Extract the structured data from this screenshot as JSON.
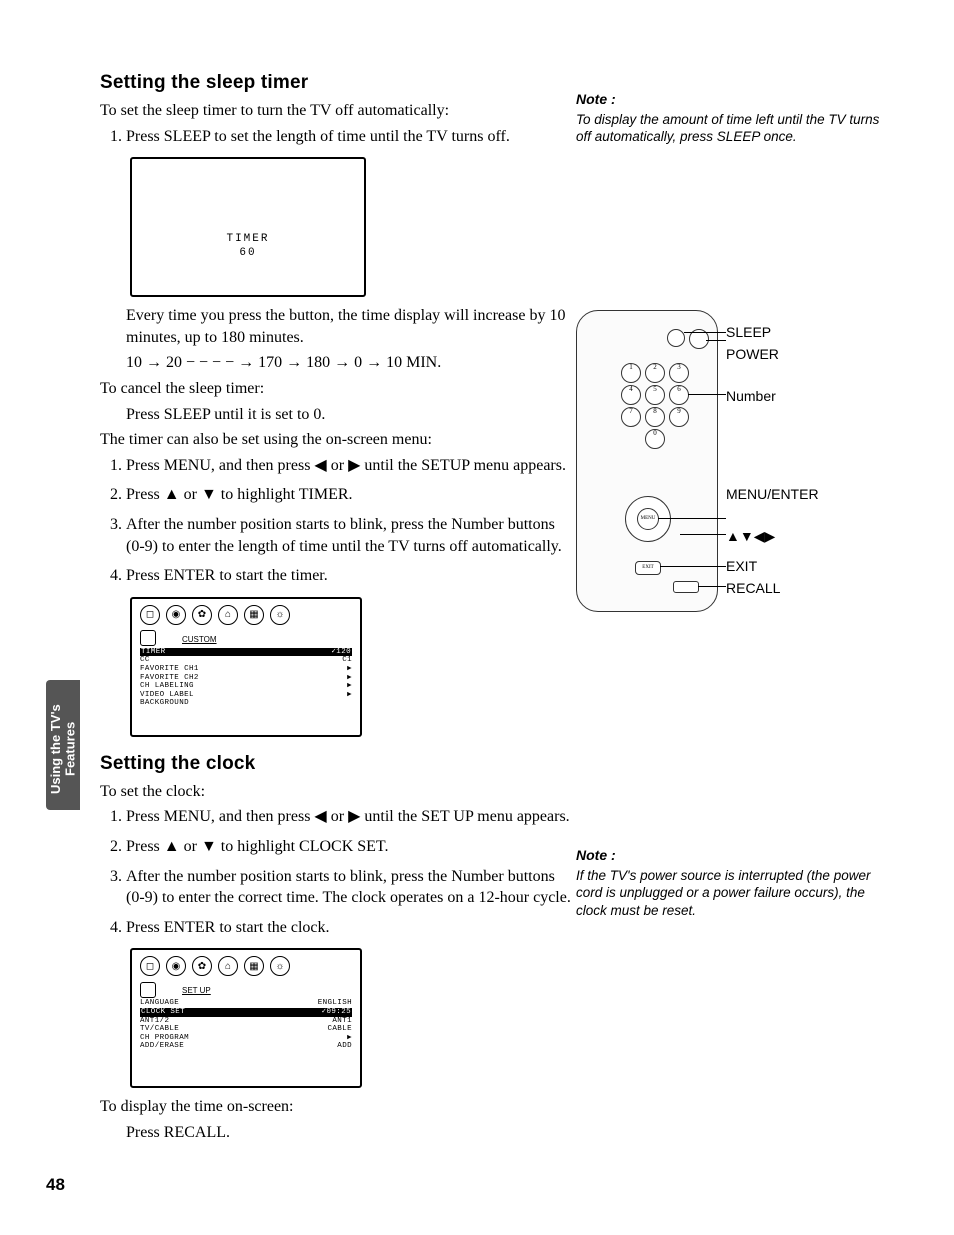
{
  "sections": {
    "sleep": {
      "title": "Setting the sleep timer",
      "intro": "To set the sleep timer to turn the TV off automatically:",
      "step1": "Press SLEEP to set the length of time until the TV turns off.",
      "screen": {
        "l1": "TIMER",
        "l2": "60"
      },
      "after_box": "Every time you press the button, the time display will increase by 10 minutes, up to 180 minutes.",
      "seq": "10 → 20 − − − − → 170 → 180 → 0 → 10 MIN.",
      "cancel_hd": "To cancel the sleep timer:",
      "cancel_body": "Press SLEEP until it is set to 0.",
      "menu_hd": "The timer can also be set using the on-screen menu:",
      "m1a": "Press MENU, and then press ",
      "m1b": " or ",
      "m1c": " until the SETUP menu appears.",
      "m2a": "Press ",
      "m2b": " or ",
      "m2c": " to highlight TIMER.",
      "m3": "After the number position starts to blink, press the Number buttons (0-9) to enter the length of time until the TV turns off automatically.",
      "m4": "Press ENTER to start the timer.",
      "menubox": {
        "label": "CUSTOM",
        "rows": [
          {
            "l": "TIMER",
            "r": "✓120",
            "hl": true
          },
          {
            "l": "CC",
            "r": "C1"
          },
          {
            "l": "FAVORITE CH1",
            "r": "▶"
          },
          {
            "l": "FAVORITE CH2",
            "r": "▶"
          },
          {
            "l": "CH LABELING",
            "r": "▶"
          },
          {
            "l": "VIDEO LABEL",
            "r": "▶"
          },
          {
            "l": "BACKGROUND",
            "r": ""
          }
        ]
      }
    },
    "clock": {
      "title": "Setting the clock",
      "intro": "To set the clock:",
      "s1a": "Press MENU, and then press ",
      "s1b": " or ",
      "s1c": " until the SET UP menu appears.",
      "s2a": "Press ",
      "s2b": " or ",
      "s2c": " to highlight CLOCK SET.",
      "s3": "After the number position starts to blink, press the Number buttons (0-9) to enter the correct time. The clock operates on a 12-hour cycle.",
      "s4": "Press ENTER to start the clock.",
      "menubox": {
        "label": "SET UP",
        "rows": [
          {
            "l": "LANGUAGE",
            "r": "ENGLISH"
          },
          {
            "l": "CLOCK SET",
            "r": "✓09:25",
            "hl": true
          },
          {
            "l": "ANT1/2",
            "r": "ANT1"
          },
          {
            "l": "TV/CABLE",
            "r": "CABLE"
          },
          {
            "l": "CH PROGRAM",
            "r": "▶"
          },
          {
            "l": "ADD/ERASE",
            "r": "ADD"
          }
        ]
      },
      "tail_hd": "To display the time on-screen:",
      "tail_body": "Press RECALL."
    }
  },
  "notes": {
    "n1_hd": "Note :",
    "n1": "To display the amount of time left until the TV turns off automatically, press SLEEP once.",
    "n2_hd": "Note :",
    "n2": "If the TV's power source is interrupted (the power cord is unplugged or a power failure occurs), the clock must be reset."
  },
  "remote_labels": {
    "sleep": "SLEEP",
    "power": "POWER",
    "number": "Number",
    "menu": "MENU/ENTER",
    "arrows": "▲▼◀▶",
    "exit": "EXIT",
    "recall": "RECALL"
  },
  "sidetab": "Using the TV's Features",
  "pagenum": "48",
  "glyphs": {
    "left": "◀",
    "right": "▶",
    "up": "▲",
    "down": "▼"
  }
}
